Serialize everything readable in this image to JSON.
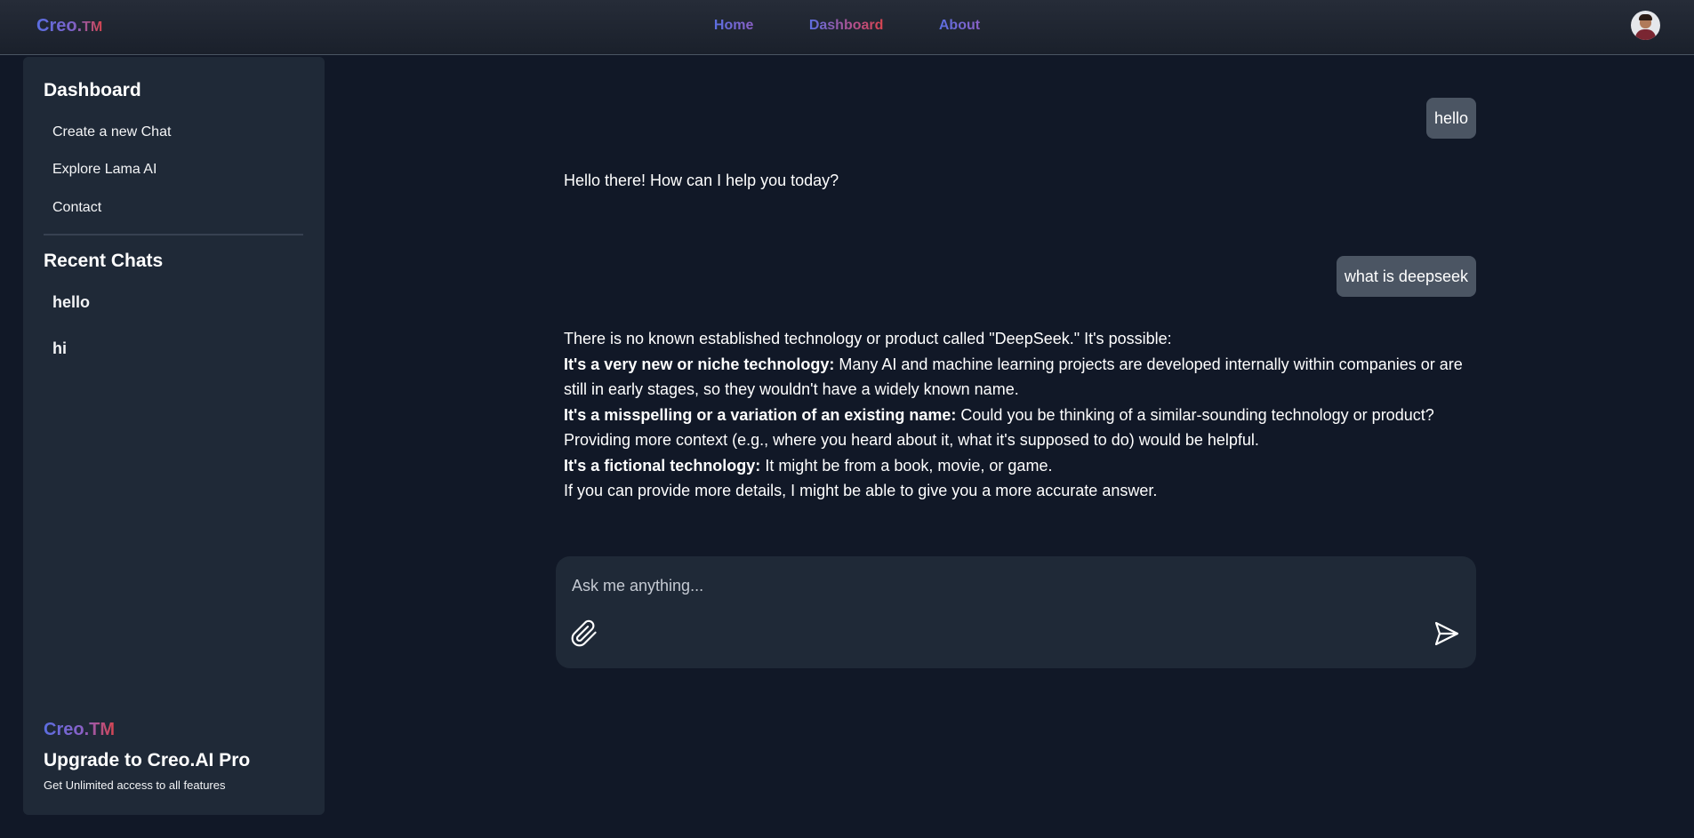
{
  "header": {
    "brand": "Creo.",
    "brand_tm": "TM",
    "nav": [
      "Home",
      "Dashboard",
      "About"
    ]
  },
  "sidebar": {
    "dashboard_title": "Dashboard",
    "links": [
      "Create a new Chat",
      "Explore Lama AI",
      "Contact"
    ],
    "recent_title": "Recent Chats",
    "recent_chats": [
      "hello",
      "hi"
    ],
    "promo": {
      "brand": "Creo.TM",
      "title": "Upgrade to Creo.AI Pro",
      "subtitle": "Get Unlimited access to all features"
    }
  },
  "chat": {
    "messages": [
      {
        "role": "user",
        "text": "hello"
      },
      {
        "role": "assistant",
        "text": "Hello there! How can I help you today?"
      },
      {
        "role": "user",
        "text": "what is deepseek"
      },
      {
        "role": "assistant",
        "intro": "There is no known established technology or product called \"DeepSeek.\" It's possible:",
        "points": [
          {
            "bold": "It's a very new or niche technology:",
            "text": " Many AI and machine learning projects are developed internally within companies or are still in early stages, so they wouldn't have a widely known name."
          },
          {
            "bold": "It's a misspelling or a variation of an existing name:",
            "text": " Could you be thinking of a similar-sounding technology or product? Providing more context (e.g., where you heard about it, what it's supposed to do) would be helpful."
          },
          {
            "bold": "It's a fictional technology:",
            "text": " It might be from a book, movie, or game."
          }
        ],
        "outro": "If you can provide more details, I might be able to give you a more accurate answer."
      }
    ]
  },
  "composer": {
    "placeholder": "Ask me anything..."
  },
  "icons": {
    "attach": "paperclip-icon",
    "send": "send-icon",
    "avatar": "user-avatar"
  },
  "colors": {
    "background": "#111827",
    "panel": "#1f2937",
    "user_bubble": "#4b5563",
    "accent_blue": "#5b6ee1",
    "accent_red": "#d64550"
  }
}
